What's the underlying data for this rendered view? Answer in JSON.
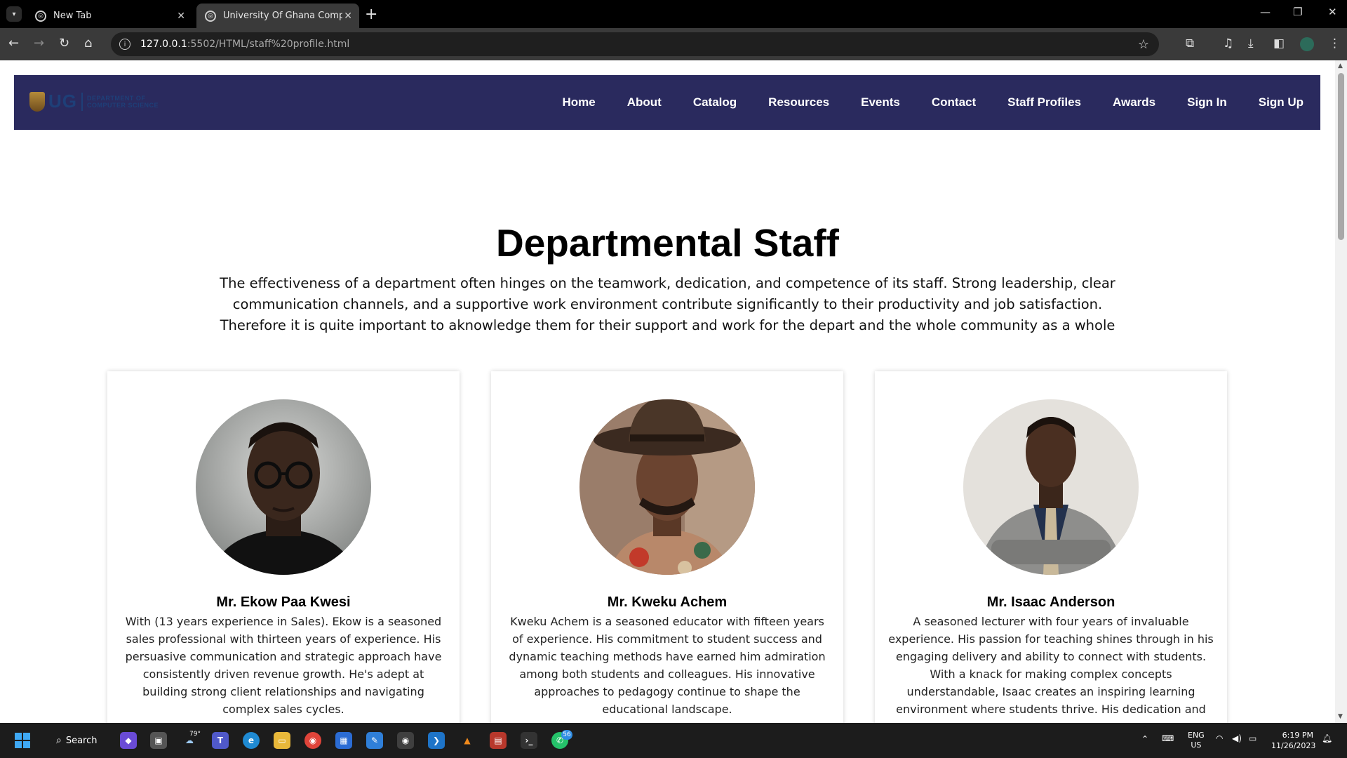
{
  "browser": {
    "tabs": [
      {
        "title": "New Tab",
        "active": false
      },
      {
        "title": "University Of Ghana Computer",
        "active": true
      }
    ],
    "url_host": "127.0.0.1",
    "url_rest": ":5502/HTML/staff%20profile.html"
  },
  "site": {
    "logo_text": "UG",
    "logo_dept_line1": "DEPARTMENT OF",
    "logo_dept_line2": "COMPUTER SCIENCE",
    "nav": [
      "Home",
      "About",
      "Catalog",
      "Resources",
      "Events",
      "Contact",
      "Staff Profiles",
      "Awards",
      "Sign In",
      "Sign Up"
    ],
    "nav_bg": "#2a2a5e"
  },
  "page": {
    "heading": "Departmental Staff",
    "intro_lines": [
      "The effectiveness of a department often hinges on the teamwork, dedication, and competence of its staff. Strong leadership, clear",
      "communication channels, and a supportive work environment contribute significantly to their productivity and job satisfaction.",
      "Therefore it is quite important to aknowledge them for their support and work for the depart and the whole community as a whole"
    ],
    "staff": [
      {
        "name": "Mr. Ekow Paa Kwesi",
        "bio": "With (13 years experience in Sales). Ekow is a seasoned sales professional with thirteen years of experience. His persuasive communication and strategic approach have consistently driven revenue growth. He's adept at building strong client relationships and navigating complex sales cycles."
      },
      {
        "name": "Mr. Kweku Achem",
        "bio": "Kweku Achem is a seasoned educator with fifteen years of experience. His commitment to student success and dynamic teaching methods have earned him admiration among both students and colleagues. His innovative approaches to pedagogy continue to shape the educational landscape."
      },
      {
        "name": "Mr. Isaac Anderson",
        "bio": "A seasoned lecturer with four years of invaluable experience. His passion for teaching shines through in his engaging delivery and ability to connect with students. With a knack for making complex concepts understandable, Isaac creates an inspiring learning environment where students thrive. His dedication and"
      }
    ]
  },
  "taskbar": {
    "search_label": "Search",
    "weather_temp": "79°",
    "whatsapp_badge": "56",
    "lang_line1": "ENG",
    "lang_line2": "US",
    "time": "6:19 PM",
    "date": "11/26/2023"
  }
}
